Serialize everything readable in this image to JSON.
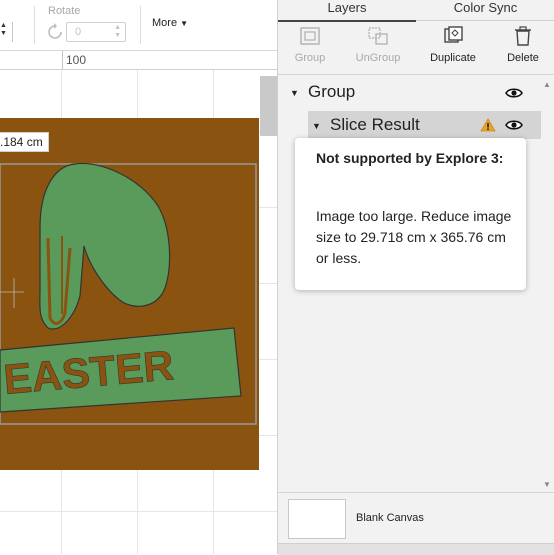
{
  "toolbar": {
    "rotate_label": "Rotate",
    "rotate_value": "0",
    "more_label": "More"
  },
  "ruler": {
    "mark": "100"
  },
  "canvas": {
    "dimension_label": ".184 cm",
    "artwork_text": "EASTER",
    "colors": {
      "background": "#8a5410",
      "leaf": "#5a9a5a",
      "outline": "#333333"
    }
  },
  "panel": {
    "tabs": [
      {
        "label": "Layers",
        "active": true
      },
      {
        "label": "Color Sync",
        "active": false
      }
    ],
    "actions": [
      {
        "label": "Group",
        "icon": "group-icon",
        "enabled": false
      },
      {
        "label": "UnGroup",
        "icon": "ungroup-icon",
        "enabled": false
      },
      {
        "label": "Duplicate",
        "icon": "duplicate-icon",
        "enabled": true
      },
      {
        "label": "Delete",
        "icon": "trash-icon",
        "enabled": true
      }
    ],
    "layers": {
      "group_name": "Group",
      "child_name": "Slice Result"
    },
    "tooltip": {
      "title": "Not supported by Explore 3:",
      "body": "Image too large. Reduce image size to 29.718 cm x 365.76 cm or less."
    },
    "blank_canvas_label": "Blank Canvas",
    "colors": {
      "warning": "#e8a52a"
    }
  }
}
